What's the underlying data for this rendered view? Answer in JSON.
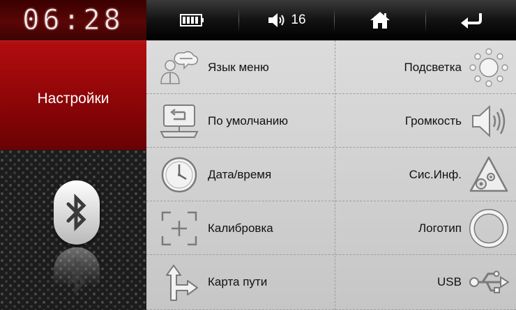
{
  "clock": {
    "time": "06:28"
  },
  "title": "Настройки",
  "status_bar": {
    "battery": "battery-icon",
    "volume_level": "16",
    "home": "home-icon",
    "back": "back-arrow-icon"
  },
  "settings": {
    "left": [
      {
        "label": "Язык меню",
        "icon": "language-icon"
      },
      {
        "label": "По умолчанию",
        "icon": "restore-default-icon"
      },
      {
        "label": "Дата/время",
        "icon": "clock-icon"
      },
      {
        "label": "Калибровка",
        "icon": "calibration-icon"
      },
      {
        "label": "Карта пути",
        "icon": "map-path-icon"
      }
    ],
    "right": [
      {
        "label": "Подсветка",
        "icon": "backlight-icon"
      },
      {
        "label": "Громкость",
        "icon": "speaker-icon"
      },
      {
        "label": "Сис.Инф.",
        "icon": "system-info-icon"
      },
      {
        "label": "Логотип",
        "icon": "logo-ring-icon"
      },
      {
        "label": "USB",
        "icon": "usb-icon"
      }
    ]
  },
  "bluetooth": {
    "icon": "bluetooth-icon"
  }
}
